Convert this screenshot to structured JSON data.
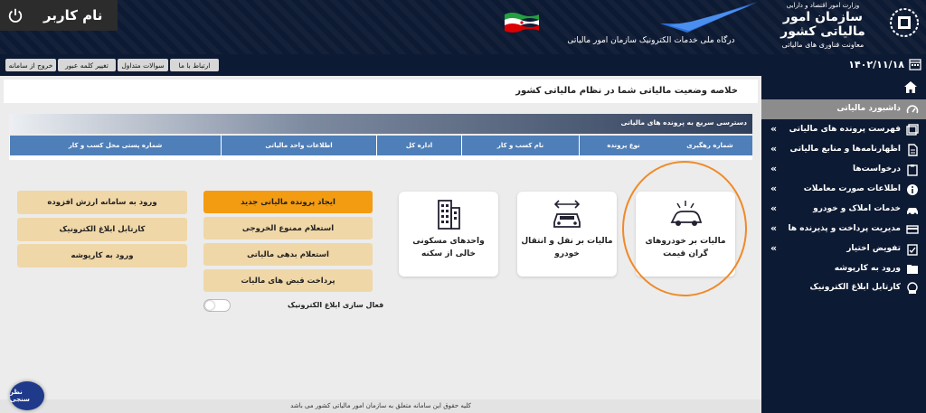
{
  "header": {
    "user_name": "نام کاربر",
    "portal_text": "درگاه ملی خدمات الکترونیک سازمان امور مالیاتی",
    "org_ministry": "وزارت امور اقتصاد و دارایی",
    "org_name": "سازمان امور مالیاتی کشور",
    "org_sub": "معاونت فناوری های مالیاتی"
  },
  "toolbar": {
    "logout": "خروج از سامانه",
    "change_password": "تغییر کلمه عبور",
    "faq": "سوالات متداول",
    "contact": "ارتباط با ما"
  },
  "date": "۱۴۰۲/۱۱/۱۸",
  "sidebar": {
    "items": [
      {
        "label": "داشبورد مالیاتی",
        "icon": "dashboard-icon",
        "active": true,
        "expandable": false
      },
      {
        "label": "فهرست پرونده های مالیاتی",
        "icon": "folders-icon",
        "expandable": true
      },
      {
        "label": "اظهارنامه‌ها و منابع مالیاتی",
        "icon": "document-icon",
        "expandable": true
      },
      {
        "label": "درخواست‌ها",
        "icon": "clipboard-icon",
        "expandable": true
      },
      {
        "label": "اطلاعات صورت معاملات",
        "icon": "info-icon",
        "expandable": true
      },
      {
        "label": "خدمات املاک و خودرو",
        "icon": "car-icon",
        "expandable": true
      },
      {
        "label": "مدیریت پرداخت و پذیرنده ها",
        "icon": "card-icon",
        "expandable": true
      },
      {
        "label": "تفویض اختیار",
        "icon": "delegate-icon",
        "expandable": true
      },
      {
        "label": "ورود به کارپوشه",
        "icon": "login-icon",
        "expandable": false
      },
      {
        "label": "کارتابل ابلاغ الکترونیک",
        "icon": "inbox-icon",
        "expandable": false
      }
    ]
  },
  "main": {
    "summary_title": "خلاصه وضعیت مالیاتی شما در نظام مالیاتی کشور",
    "quick_access_title": "دسترسی سریع به پرونده های مالیاتی",
    "table_headers": [
      "شماره رهگیری",
      "نوع پرونده",
      "نام کسب و کار",
      "اداره کل",
      "اطلاعات واحد مالیاتی",
      "شماره پستی محل کسب و کار"
    ],
    "tiles": [
      {
        "label": "مالیات بر خودروهای گران قیمت",
        "icon": "luxury-car-icon"
      },
      {
        "label": "مالیات بر نقل و انتقال خودرو",
        "icon": "car-transfer-icon"
      },
      {
        "label": "واحدهای مسکونی خالی از سکنه",
        "icon": "building-icon"
      }
    ],
    "actions": [
      {
        "label": "ایجاد پرونده مالیاتی جدید",
        "primary": true
      },
      {
        "label": "استعلام ممنوع الخروجی",
        "primary": false
      },
      {
        "label": "استعلام بدهی مالیاتی",
        "primary": false
      },
      {
        "label": "پرداخت قبض های مالیات",
        "primary": false
      }
    ],
    "side_actions": [
      {
        "label": "ورود به سامانه ارزش افزوده"
      },
      {
        "label": "کارتابل ابلاغ الکترونیک"
      },
      {
        "label": "ورود به کارپوشه"
      }
    ],
    "toggle_label": "فعال سازی ابلاغ الکترونیک",
    "toggle_on": false,
    "footer": "کلیه حقوق این سامانه متعلق به سازمان امور مالیاتی کشور می باشد",
    "survey": "نظر سنجی"
  },
  "colors": {
    "navy": "#0d1a33",
    "accent": "#f39c12",
    "button": "#f0d7a7",
    "table_head": "#4f7fb8",
    "ring": "#f08a28"
  }
}
